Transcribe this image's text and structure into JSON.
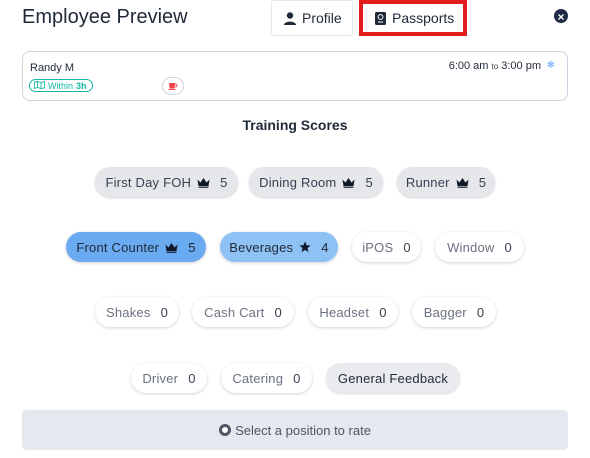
{
  "header": {
    "title": "Employee Preview",
    "tabs": [
      {
        "label": "Profile",
        "icon": "user-icon"
      },
      {
        "label": "Passports",
        "icon": "passport-icon",
        "highlighted": true
      }
    ],
    "close_icon": "close-icon"
  },
  "employee": {
    "name": "Randy M",
    "within_prefix": "Within",
    "within_value": "3h",
    "shift_start": "6:00 am",
    "shift_to": "to",
    "shift_end": "3:00 pm"
  },
  "training": {
    "title": "Training Scores",
    "positions": [
      {
        "label": "First Day FOH",
        "icon": "crown",
        "score": "5"
      },
      {
        "label": "Dining Room",
        "icon": "crown",
        "score": "5"
      },
      {
        "label": "Runner",
        "icon": "crown",
        "score": "5"
      },
      {
        "label": "Front Counter",
        "icon": "crown",
        "score": "5"
      },
      {
        "label": "Beverages",
        "icon": "star",
        "score": "4"
      },
      {
        "label": "iPOS",
        "score": "0"
      },
      {
        "label": "Window",
        "score": "0"
      },
      {
        "label": "Shakes",
        "score": "0"
      },
      {
        "label": "Cash Cart",
        "score": "0"
      },
      {
        "label": "Headset",
        "score": "0"
      },
      {
        "label": "Bagger",
        "score": "0"
      },
      {
        "label": "Driver",
        "score": "0"
      },
      {
        "label": "Catering",
        "score": "0"
      },
      {
        "label": "General Feedback"
      }
    ]
  },
  "footer": {
    "prompt": "Select a position to rate"
  },
  "colors": {
    "highlight_border": "#e11d1d",
    "crown_chip": "#e5e7eb",
    "top_score_chip": "#6aaaf0",
    "star_chip": "#8fc2f4",
    "within_badge": "#14b8a6"
  }
}
